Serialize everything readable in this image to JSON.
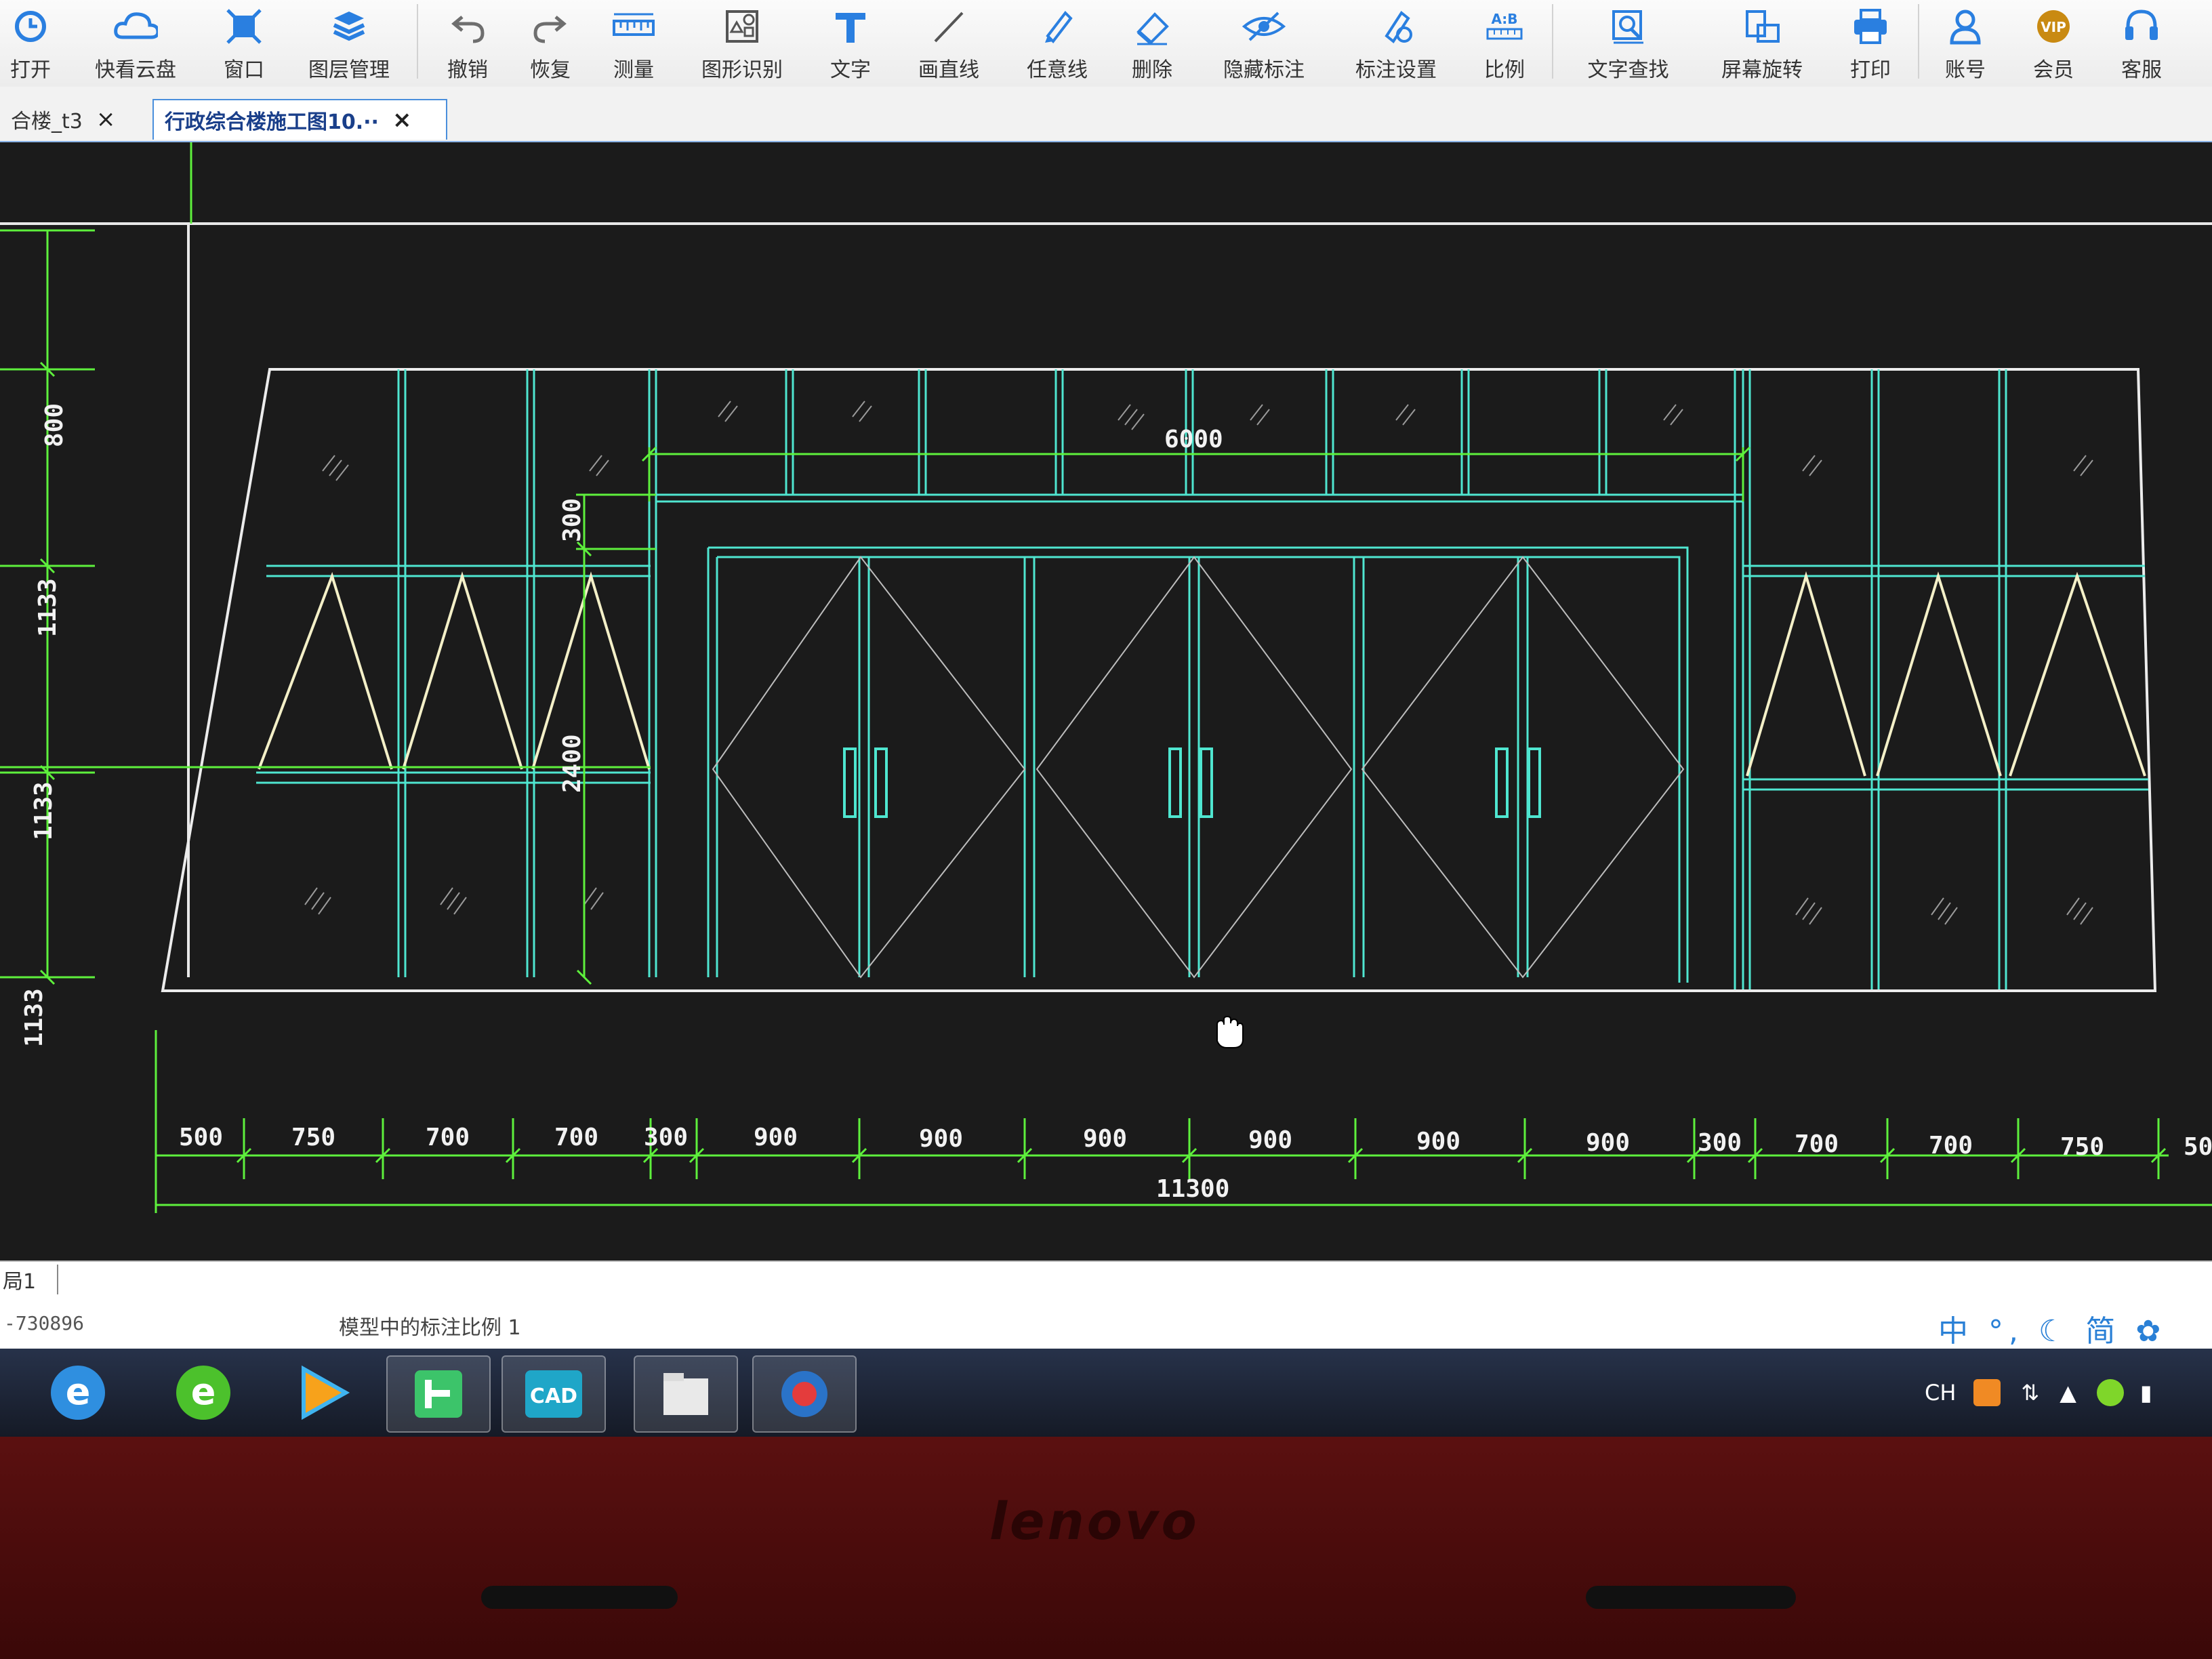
{
  "toolbar": {
    "open": "打开",
    "cloud": "快看云盘",
    "window": "窗口",
    "layers": "图层管理",
    "undo": "撤销",
    "redo": "恢复",
    "measure": "测量",
    "recognize": "图形识别",
    "text": "文字",
    "line": "画直线",
    "freeline": "任意线",
    "delete": "删除",
    "hide": "隐藏标注",
    "annot_settings": "标注设置",
    "ratio": "比例",
    "ratio_icon_text": "A:B",
    "find_text": "文字查找",
    "rotate": "屏幕旋转",
    "print": "打印",
    "account": "账号",
    "vip": "会员",
    "vip_badge": "VIP",
    "service": "客服"
  },
  "tabs": [
    {
      "label": "合楼_t3",
      "close": "×"
    },
    {
      "label": "行政综合楼施工图10.··",
      "close": "×"
    }
  ],
  "drawing": {
    "dims_left": [
      "800",
      "1133",
      "1133",
      "1133"
    ],
    "dim_300": "300",
    "dim_2400": "2400",
    "dim_6000": "6000",
    "dims_bottom": [
      "500",
      "750",
      "700",
      "700",
      "300",
      "900",
      "900",
      "900",
      "900",
      "900",
      "900",
      "300",
      "700",
      "700",
      "750",
      "50"
    ],
    "dim_total": "11300"
  },
  "status": {
    "layout_tab": "局1",
    "coords": "-730896",
    "message": "模型中的标注比例 1",
    "ime": "中 °, ☾ 简 ✿"
  },
  "taskbar": {
    "app_cad": "CAD",
    "tray_lang": "CH"
  },
  "bezel": {
    "brand": "lenovo"
  }
}
